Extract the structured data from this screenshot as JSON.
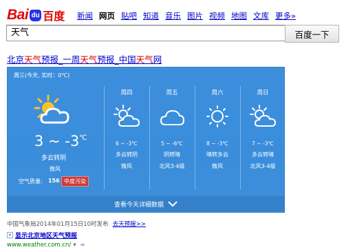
{
  "header": {
    "logo_latin": "Bai",
    "logo_paw": "du",
    "logo_cn": "百度",
    "nav": [
      {
        "label": "新闻",
        "active": false
      },
      {
        "label": "网页",
        "active": true
      },
      {
        "label": "贴吧",
        "active": false
      },
      {
        "label": "知道",
        "active": false
      },
      {
        "label": "音乐",
        "active": false
      },
      {
        "label": "图片",
        "active": false
      },
      {
        "label": "视频",
        "active": false
      },
      {
        "label": "地图",
        "active": false
      },
      {
        "label": "文库",
        "active": false
      },
      {
        "label": "更多»",
        "active": false
      }
    ]
  },
  "search": {
    "value": "天气",
    "button_label": "百度一下"
  },
  "result": {
    "title_parts": [
      "北京",
      "天气",
      "预报_一周",
      "天气",
      "预报_中国",
      "天气",
      "网"
    ]
  },
  "weather": {
    "today_header": "周三(今天, 实时：0℃)",
    "today_temp": "3 ~ -3",
    "today_temp_unit": "℃",
    "today_cond": "多云转阴",
    "today_wind": "微风",
    "aq_label": "空气质量:",
    "aq_value": "156",
    "aq_badge": "中度污染",
    "days": [
      {
        "name": "周四",
        "temp": "6 ~ -3℃",
        "cond": "多云转阴",
        "wind": "微风",
        "icon": "partly-cloudy-icon"
      },
      {
        "name": "周五",
        "temp": "5 ~ -6℃",
        "cond": "阴转晴",
        "wind": "北风3-4级",
        "icon": "cloud-icon"
      },
      {
        "name": "周六",
        "temp": "8 ~ -3℃",
        "cond": "晴转多云",
        "wind": "微风",
        "icon": "sun-icon"
      },
      {
        "name": "周日",
        "temp": "7 ~ -3℃",
        "cond": "多云转晴",
        "wind": "北风3-4级",
        "icon": "partly-cloudy-icon"
      }
    ],
    "more_label": "查看今天详细数据"
  },
  "footer": {
    "source": "中国气象局2014年01月15日10时发布",
    "feedback_link": "去天预报>>",
    "expand_label": "显示北京地区天气预报",
    "url": "www.weather.com.cn/",
    "url_arrow": "▾"
  },
  "colors": {
    "panel_bg": "#3d8fdc",
    "link": "#0000cc",
    "highlight": "#cc0000",
    "url_green": "#008000",
    "aq_badge": "#cc3b3b",
    "sun_yellow": "#f6c22b"
  }
}
